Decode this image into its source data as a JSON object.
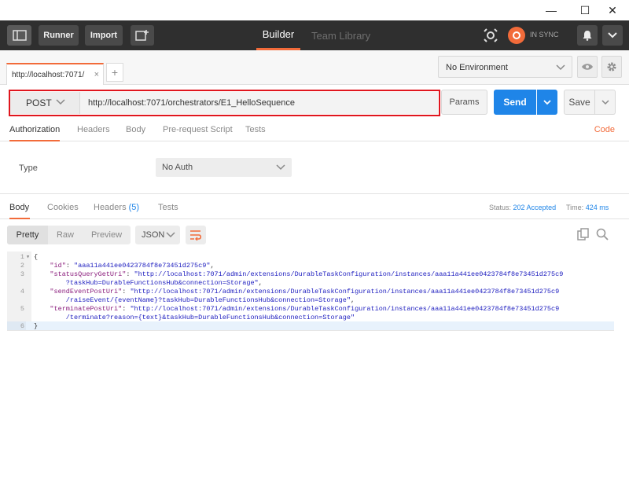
{
  "window": {
    "minimize": "—",
    "maximize": "☐",
    "close": "✕"
  },
  "header": {
    "runner": "Runner",
    "import": "Import",
    "tabs": {
      "builder": "Builder",
      "team_library": "Team Library"
    },
    "sync_status": "IN SYNC"
  },
  "tabbar": {
    "request_tab": "http://localhost:7071/",
    "close": "×",
    "add": "+",
    "environment": "No Environment"
  },
  "request": {
    "method": "POST",
    "url": "http://localhost:7071/orchestrators/E1_HelloSequence",
    "params": "Params",
    "send": "Send",
    "save": "Save",
    "tabs": [
      "Authorization",
      "Headers",
      "Body",
      "Pre-request Script",
      "Tests"
    ],
    "code_link": "Code",
    "auth": {
      "type_label": "Type",
      "type_value": "No Auth"
    }
  },
  "response": {
    "tabs": {
      "body": "Body",
      "cookies": "Cookies",
      "headers": "Headers",
      "headers_count": "(5)",
      "tests": "Tests"
    },
    "status_label": "Status:",
    "status_value": "202 Accepted",
    "time_label": "Time:",
    "time_value": "424 ms",
    "views": [
      "Pretty",
      "Raw",
      "Preview"
    ],
    "format": "JSON",
    "lines": [
      {
        "n": "1",
        "fold": "▾",
        "parts": [
          [
            "txt",
            "{"
          ]
        ]
      },
      {
        "n": "2",
        "fold": "",
        "parts": [
          [
            "txt",
            "    "
          ],
          [
            "k",
            "\"id\""
          ],
          [
            "txt",
            ": "
          ],
          [
            "s",
            "\"aaa11a441ee0423784f8e73451d275c9\""
          ],
          [
            "txt",
            ","
          ]
        ]
      },
      {
        "n": "3",
        "fold": "",
        "parts": [
          [
            "txt",
            "    "
          ],
          [
            "k",
            "\"statusQueryGetUri\""
          ],
          [
            "txt",
            ": "
          ],
          [
            "s",
            "\"http://localhost:7071/admin/extensions/DurableTaskConfiguration/instances/aaa11a441ee0423784f8e73451d275c9"
          ]
        ]
      },
      {
        "n": "",
        "fold": "",
        "parts": [
          [
            "s",
            "        ?taskHub=DurableFunctionsHub&connection=Storage\""
          ],
          [
            "txt",
            ","
          ]
        ]
      },
      {
        "n": "4",
        "fold": "",
        "parts": [
          [
            "txt",
            "    "
          ],
          [
            "k",
            "\"sendEventPostUri\""
          ],
          [
            "txt",
            ": "
          ],
          [
            "s",
            "\"http://localhost:7071/admin/extensions/DurableTaskConfiguration/instances/aaa11a441ee0423784f8e73451d275c9"
          ]
        ]
      },
      {
        "n": "",
        "fold": "",
        "parts": [
          [
            "s",
            "        /raiseEvent/{eventName}?taskHub=DurableFunctionsHub&connection=Storage\""
          ],
          [
            "txt",
            ","
          ]
        ]
      },
      {
        "n": "5",
        "fold": "",
        "parts": [
          [
            "txt",
            "    "
          ],
          [
            "k",
            "\"terminatePostUri\""
          ],
          [
            "txt",
            ": "
          ],
          [
            "s",
            "\"http://localhost:7071/admin/extensions/DurableTaskConfiguration/instances/aaa11a441ee0423784f8e73451d275c9"
          ]
        ]
      },
      {
        "n": "",
        "fold": "",
        "parts": [
          [
            "s",
            "        /terminate?reason={text}&taskHub=DurableFunctionsHub&connection=Storage\""
          ]
        ]
      },
      {
        "n": "6",
        "fold": "",
        "parts": [
          [
            "txt",
            "}"
          ]
        ]
      }
    ]
  },
  "colors": {
    "accent": "#f26b3a",
    "primary": "#1f85e8",
    "highlight_border": "#e0161e",
    "header_bg": "#2f2f2f"
  }
}
